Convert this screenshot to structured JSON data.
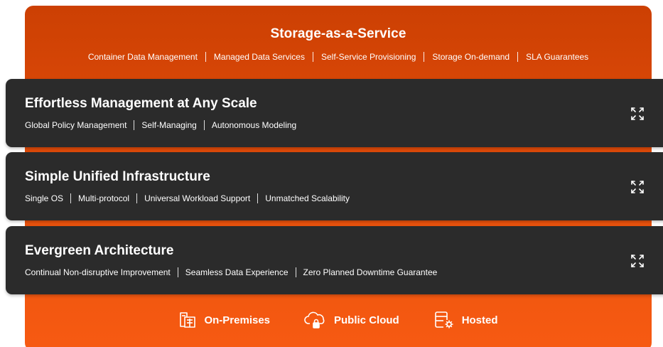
{
  "storage_service": {
    "title": "Storage-as-a-Service",
    "features": [
      "Container Data Management",
      "Managed Data Services",
      "Self-Service Provisioning",
      "Storage On-demand",
      "SLA Guarantees"
    ]
  },
  "cards": [
    {
      "title": "Effortless Management at Any Scale",
      "features": [
        "Global Policy Management",
        "Self-Managing",
        "Autonomous Modeling"
      ],
      "expand_icon": "expand-icon"
    },
    {
      "title": "Simple Unified Infrastructure",
      "features": [
        "Single OS",
        "Multi-protocol",
        "Universal Workload Support",
        "Unmatched Scalability"
      ],
      "expand_icon": "expand-icon"
    },
    {
      "title": "Evergreen Architecture",
      "features": [
        "Continual Non-disruptive Improvement",
        "Seamless Data Experience",
        "Zero Planned Downtime Guarantee"
      ],
      "expand_icon": "expand-icon"
    }
  ],
  "deployment": [
    {
      "label": "On-Premises",
      "icon": "buildings-icon"
    },
    {
      "label": "Public Cloud",
      "icon": "cloud-lock-icon"
    },
    {
      "label": "Hosted",
      "icon": "server-gear-icon"
    }
  ],
  "colors": {
    "orange_top": "#cc4003",
    "orange_bottom": "#f75a12",
    "card_bg": "#2b2b2b",
    "text": "#ffffff"
  }
}
